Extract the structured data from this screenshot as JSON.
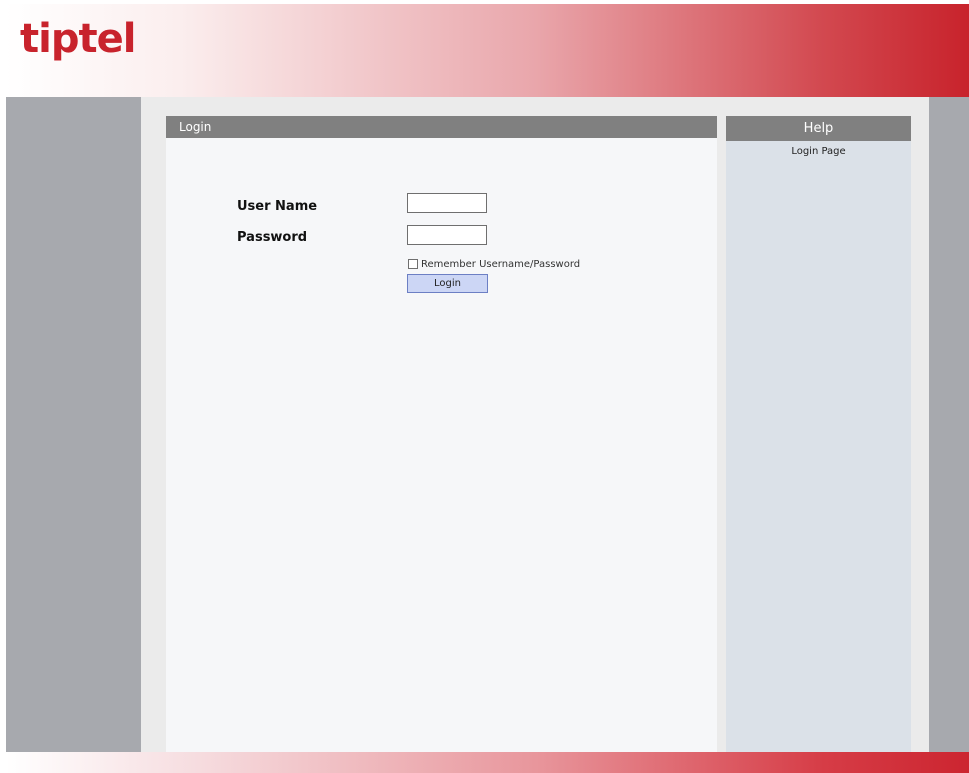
{
  "brand": {
    "logo_text": "tiptel",
    "accent_color": "#c8232c"
  },
  "login_panel": {
    "title": "Login",
    "username_label": "User Name",
    "username_value": "",
    "password_label": "Password",
    "password_value": "",
    "remember_label": "Remember Username/Password",
    "remember_checked": false,
    "login_button_label": "Login"
  },
  "help_panel": {
    "title": "Help",
    "text": "Login Page"
  }
}
